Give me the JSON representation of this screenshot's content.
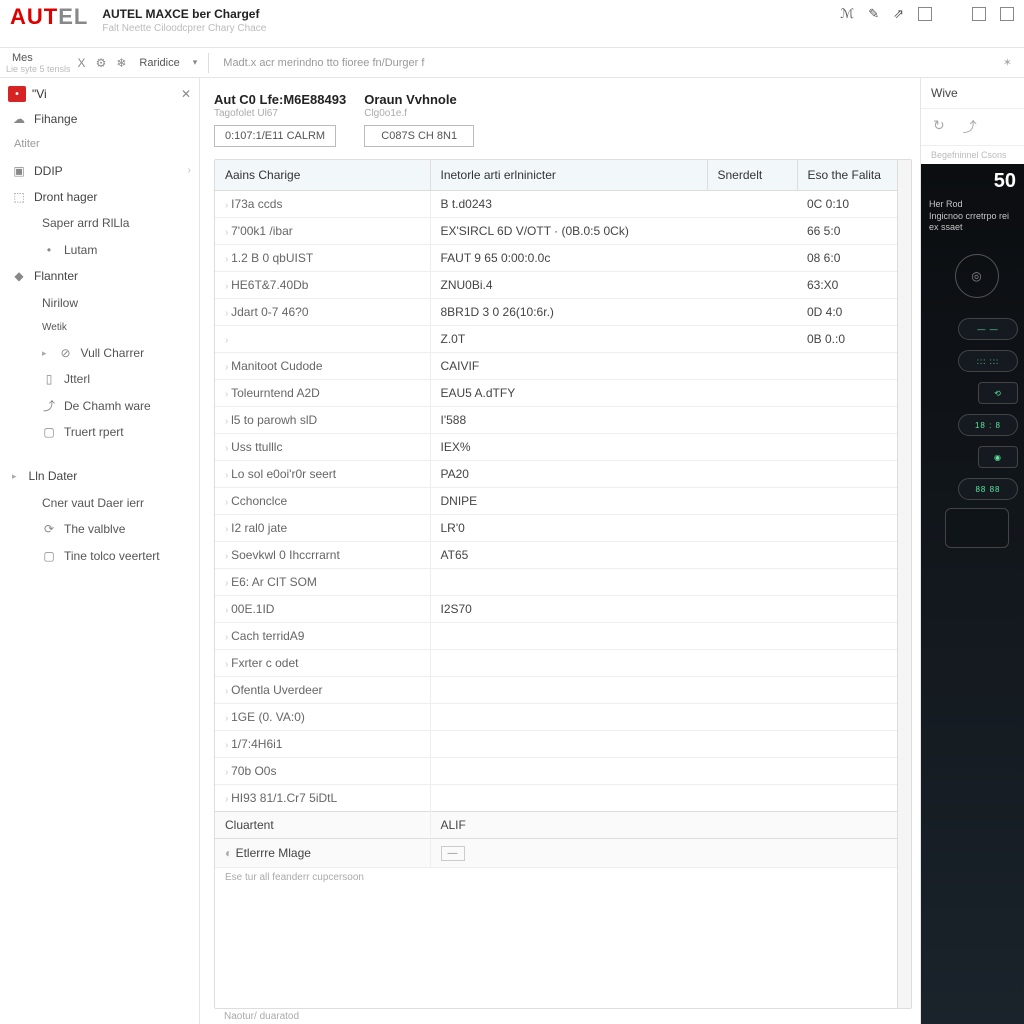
{
  "brand": {
    "a": "AUT",
    "b": "EL"
  },
  "title": {
    "line1": "AUTEL MAXCE ber Chargef",
    "line2": "Falt Neette Ciloodcprer Chary Chace"
  },
  "title_icons": [
    "m",
    "edit",
    "m",
    "sq",
    "sq",
    "sq"
  ],
  "toolbar": {
    "menu": "Mes",
    "menu_sub": "Lie syte 5 tensls",
    "word2": "Raridice",
    "text": "Madt.x acr merindno tto fioree fn/Durger f"
  },
  "sidebar": {
    "head": "\"Vi",
    "items": [
      {
        "label": "Fihange",
        "icon": "☁",
        "top": true,
        "blue": false,
        "inter": true
      },
      {
        "label": "Atiter",
        "muted": true
      },
      {
        "label": "DDIP",
        "icon": "▣",
        "top": true,
        "arrow": true,
        "inter": true
      },
      {
        "label": "Dront hager",
        "icon": "⬚",
        "top": true,
        "inter": true
      },
      {
        "label": "Saper arrd RlLla",
        "sub": true
      },
      {
        "label": "Lutam",
        "sub": true,
        "blue": true,
        "icon": "•"
      },
      {
        "label": "Flannter",
        "icon": "◆",
        "top": true,
        "inter": true
      },
      {
        "label": "Nirilow",
        "sub": true
      },
      {
        "label": "Wetik",
        "sub": true,
        "blue": true,
        "tiny": true
      },
      {
        "label": "Vull Charrer",
        "icon": "⊘",
        "sub": true,
        "caret": true,
        "inter": true
      },
      {
        "label": "Jtterl",
        "icon": "▯",
        "sub": true,
        "inter": true
      },
      {
        "label": "De Chamh ware",
        "icon": "⤴",
        "sub": true,
        "inter": true
      },
      {
        "label": "Truert rpert",
        "icon": "▢",
        "sub": true,
        "inter": true
      },
      {
        "label": "Lln Dater",
        "caret": true,
        "top": true,
        "color": "#888"
      },
      {
        "label": "Cner vaut Daer ierr",
        "sub": true
      },
      {
        "label": "The valblve",
        "icon": "⟳",
        "sub": true,
        "inter": true
      },
      {
        "label": "Tine tolco veertert",
        "icon": "▢",
        "sub": true,
        "inter": true
      }
    ]
  },
  "cards": [
    {
      "title": "Aut C0 Lfe:M6E88493",
      "sub": "Tagofolet Ul67",
      "btn": "0:107:1/E11 CALRM"
    },
    {
      "title": "Oraun Vvhnole",
      "sub": "Clg0o1e.f",
      "btn": "C087S CH 8N1"
    }
  ],
  "table": {
    "headers": [
      "Aains Charige",
      "Inetorle arti erlninicter",
      "Snerdelt",
      "Eso the Falita"
    ],
    "rows": [
      [
        "I73a ccds",
        "B t.d0243",
        "",
        "0C 0:10"
      ],
      [
        "7'00k1 /ibar",
        "EX'SIRCL 6D V/OTT · (0B.0:5 0Ck)",
        "",
        "66 5:0"
      ],
      [
        "1.2 B 0 qbUIST",
        "FAUT 9 65 0:00:0.0c",
        "",
        "08 6:0"
      ],
      [
        "HE6T&7.40Db",
        "ZNU0Bi.4",
        "",
        "63:X0"
      ],
      [
        "Jdart 0-7 46?0",
        "8BR1D 3 0 26(10:6r.)",
        "",
        "0D 4:0"
      ],
      [
        "",
        "Z.0T",
        "",
        "0B 0.:0"
      ],
      [
        "Manitoot Cudode",
        "CAIVIF",
        "",
        ""
      ],
      [
        "Toleurntend A2D",
        "EAU5 A.dTFY",
        "",
        ""
      ],
      [
        "l5 to parowh slD",
        "I'588",
        "",
        ""
      ],
      [
        "Uss ttulllc",
        "IEX%",
        "",
        ""
      ],
      [
        "Lo sol e0oi'r0r seert",
        "PA20",
        "",
        ""
      ],
      [
        "Cchonclce",
        "DNIPE",
        "",
        ""
      ],
      [
        "I2 ral0 jate",
        "LR'0",
        "",
        ""
      ],
      [
        "Soevkwl 0 Ihccrrarnt",
        "AT65",
        "",
        ""
      ],
      [
        "E6: Ar CIT SOM",
        "",
        "",
        ""
      ],
      [
        "00E.1ID",
        "I2S70",
        "",
        ""
      ],
      [
        "Cach terridA9",
        "",
        "",
        ""
      ],
      [
        "Fxrter c odet",
        "",
        "",
        ""
      ],
      [
        "Ofentla Uverdeer",
        "",
        "",
        ""
      ],
      [
        "1GE (0. VA:0)",
        "",
        "",
        ""
      ],
      [
        "1/7:4H6i1",
        "",
        "",
        ""
      ],
      [
        "70b O0s",
        "",
        "",
        ""
      ],
      [
        "HI93 81/1.Cr7 5iDtL",
        "",
        "",
        ""
      ]
    ],
    "footer": {
      "c1": "Cluartent",
      "c2": "ALIF",
      "c3_label": "Etlerrre Mlage",
      "c3_box": "—",
      "note": "Ese tur all feanderr cupcersoon",
      "bar": "Naotur/ duaratod"
    }
  },
  "right": {
    "head": "Wive",
    "sub": "Begefninnel Csons",
    "big": "50",
    "line1": "Her Rod",
    "line2": "Ingicnoo crretrpo rei",
    "line3": "ex ssaet"
  }
}
